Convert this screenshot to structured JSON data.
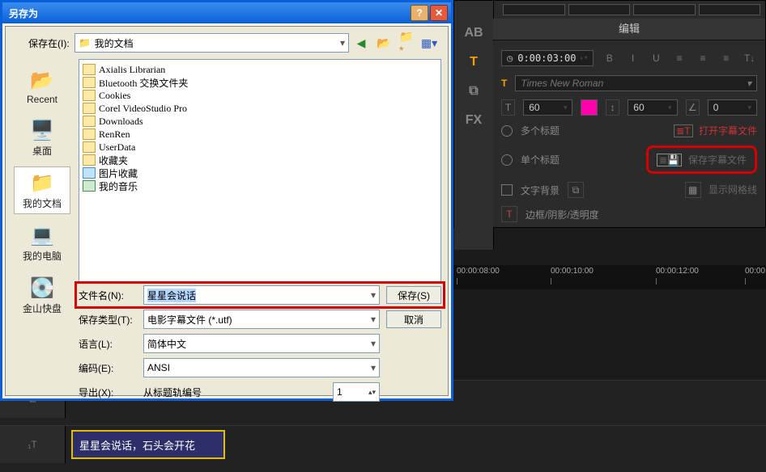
{
  "editor": {
    "header": "编辑",
    "sidebar": [
      "AB",
      "T",
      "⧉",
      "FX"
    ],
    "timecode": "0:00:03:00",
    "fmt": [
      "B",
      "I",
      "U",
      "≡",
      "≡",
      "≡",
      "T↓"
    ],
    "font_name": "Times New Roman",
    "size1": "60",
    "size2": "60",
    "size3": "0",
    "opts": {
      "multi": "多个标题",
      "single": "单个标题",
      "bg": "文字背景",
      "border": "边框/阴影/透明度",
      "open_sub": "打开字幕文件",
      "save_sub": "保存字幕文件",
      "grid": "显示网格线"
    }
  },
  "timeline": {
    "ticks": [
      "00:00:08:00",
      "00:00:10:00",
      "00:00:12:00",
      "00:00"
    ]
  },
  "clip_text": "星星会说话，石头会开花",
  "dialog": {
    "title": "另存为",
    "save_in_label": "保存在(I):",
    "save_in_value": "我的文档",
    "places": [
      {
        "label": "Recent",
        "icon": "📂"
      },
      {
        "label": "桌面",
        "icon": "🖥️"
      },
      {
        "label": "我的文档",
        "icon": "📁",
        "selected": true
      },
      {
        "label": "我的电脑",
        "icon": "💻"
      },
      {
        "label": "金山快盘",
        "icon": "💽"
      }
    ],
    "files": [
      {
        "name": "Axialis Librarian",
        "type": "folder"
      },
      {
        "name": "Bluetooth 交换文件夹",
        "type": "folder"
      },
      {
        "name": "Cookies",
        "type": "folder"
      },
      {
        "name": "Corel VideoStudio Pro",
        "type": "folder"
      },
      {
        "name": "Downloads",
        "type": "folder"
      },
      {
        "name": "RenRen",
        "type": "folder"
      },
      {
        "name": "UserData",
        "type": "folder"
      },
      {
        "name": "收藏夹",
        "type": "folder"
      },
      {
        "name": "图片收藏",
        "type": "pic"
      },
      {
        "name": "我的音乐",
        "type": "music"
      }
    ],
    "labels": {
      "filename": "文件名(N):",
      "filetype": "保存类型(T):",
      "language": "语言(L):",
      "encoding": "编码(E):",
      "export": "导出(X):"
    },
    "values": {
      "filename": "星星会说话",
      "filetype": "电影字幕文件 (*.utf)",
      "language": "简体中文",
      "encoding": "ANSI",
      "export": "从标题轨编号",
      "export_num": "1"
    },
    "buttons": {
      "save": "保存(S)",
      "cancel": "取消"
    }
  }
}
